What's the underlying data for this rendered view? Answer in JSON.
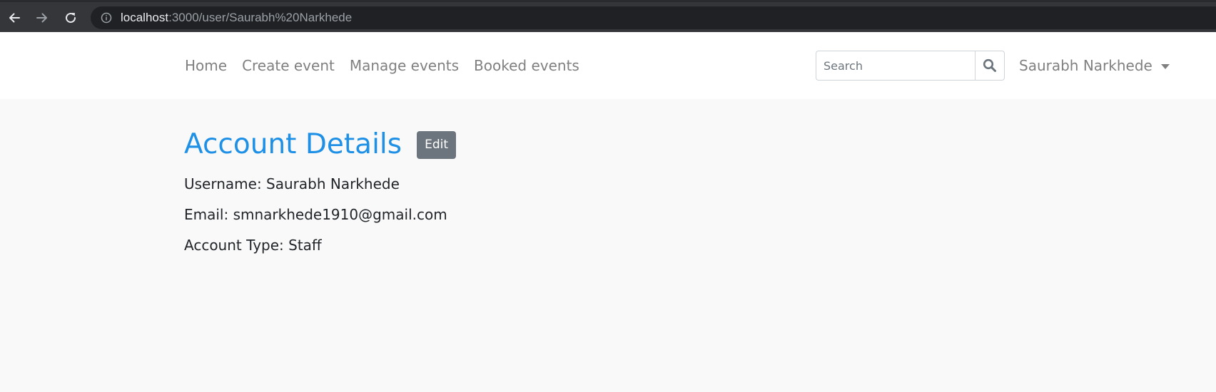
{
  "browser": {
    "url_host": "localhost",
    "url_path": ":3000/user/Saurabh%20Narkhede"
  },
  "navbar": {
    "links": [
      {
        "label": "Home"
      },
      {
        "label": "Create event"
      },
      {
        "label": "Manage events"
      },
      {
        "label": "Booked events"
      }
    ],
    "search_placeholder": "Search",
    "user_name": "Saurabh Narkhede"
  },
  "account": {
    "title": "Account Details",
    "edit_label": "Edit",
    "username_line": "Username: Saurabh Narkhede",
    "email_line": "Email: smnarkhede1910@gmail.com",
    "type_line": "Account Type: Staff"
  },
  "colors": {
    "title": "#1e90e6",
    "edit_button": "#6c757d",
    "nav_text": "#808080",
    "page_background": "#f9f9f9"
  },
  "icons": {
    "back": "arrow-left-icon",
    "forward": "arrow-right-icon",
    "reload": "reload-icon",
    "site_info": "info-icon",
    "search": "search-icon",
    "dropdown": "caret-down-icon"
  }
}
